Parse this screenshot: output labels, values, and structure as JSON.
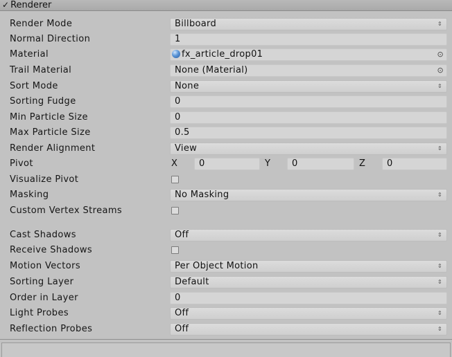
{
  "header": {
    "title": "Renderer",
    "enabled": true
  },
  "rows": {
    "render_mode": {
      "label": "Render Mode",
      "value": "Billboard"
    },
    "normal_direction": {
      "label": "Normal Direction",
      "value": "1"
    },
    "material": {
      "label": "Material",
      "value": "fx_article_drop01"
    },
    "trail_material": {
      "label": "Trail Material",
      "value": "None (Material)"
    },
    "sort_mode": {
      "label": "Sort Mode",
      "value": "None"
    },
    "sorting_fudge": {
      "label": "Sorting Fudge",
      "value": "0"
    },
    "min_particle_size": {
      "label": "Min Particle Size",
      "value": "0"
    },
    "max_particle_size": {
      "label": "Max Particle Size",
      "value": "0.5"
    },
    "render_alignment": {
      "label": "Render Alignment",
      "value": "View"
    },
    "pivot": {
      "label": "Pivot",
      "x_label": "X",
      "x": "0",
      "y_label": "Y",
      "y": "0",
      "z_label": "Z",
      "z": "0"
    },
    "visualize_pivot": {
      "label": "Visualize Pivot",
      "checked": false
    },
    "masking": {
      "label": "Masking",
      "value": "No Masking"
    },
    "custom_vertex_streams": {
      "label": "Custom Vertex Streams",
      "checked": false
    },
    "cast_shadows": {
      "label": "Cast Shadows",
      "value": "Off"
    },
    "receive_shadows": {
      "label": "Receive Shadows",
      "checked": false
    },
    "motion_vectors": {
      "label": "Motion Vectors",
      "value": "Per Object Motion"
    },
    "sorting_layer": {
      "label": "Sorting Layer",
      "value": "Default"
    },
    "order_in_layer": {
      "label": "Order in Layer",
      "value": "0"
    },
    "light_probes": {
      "label": "Light Probes",
      "value": "Off"
    },
    "reflection_probes": {
      "label": "Reflection Probes",
      "value": "Off"
    }
  },
  "icons": {
    "dropdown_arrows": "⇕",
    "object_picker": "⊙",
    "check": "✓"
  }
}
